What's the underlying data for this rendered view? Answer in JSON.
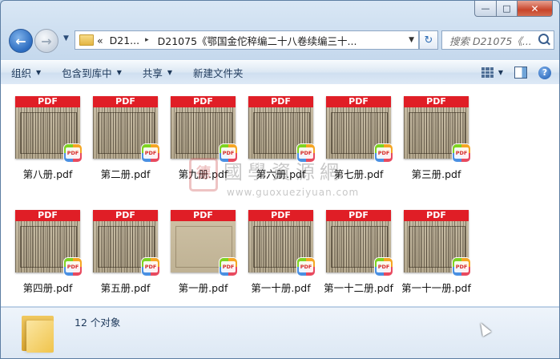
{
  "window": {
    "caption_buttons": {
      "minimize": "—",
      "maximize": "□",
      "close": "✕"
    }
  },
  "nav": {
    "back_glyph": "←",
    "forward_glyph": "→",
    "history_glyph": "▼",
    "address": {
      "overflow": "«",
      "crumb1": "D21...",
      "crumb2": "D21075《鄂国金佗稡编二十八卷续编三十...",
      "separator": "▸",
      "dropdown": "▼"
    },
    "refresh_glyph": "↻",
    "search_placeholder": "搜索 D21075《..."
  },
  "toolbar": {
    "organize": "组织",
    "include_in_library": "包含到库中",
    "share": "共享",
    "new_folder": "新建文件夹",
    "dropdown_glyph": "▼",
    "help_glyph": "?"
  },
  "files": [
    {
      "name": "第八册.pdf",
      "badge": "PDF",
      "plain": false
    },
    {
      "name": "第二册.pdf",
      "badge": "PDF",
      "plain": false
    },
    {
      "name": "第九册.pdf",
      "badge": "PDF",
      "plain": false
    },
    {
      "name": "第六册.pdf",
      "badge": "PDF",
      "plain": false
    },
    {
      "name": "第七册.pdf",
      "badge": "PDF",
      "plain": false
    },
    {
      "name": "第三册.pdf",
      "badge": "PDF",
      "plain": false
    },
    {
      "name": "第四册.pdf",
      "badge": "PDF",
      "plain": false
    },
    {
      "name": "第五册.pdf",
      "badge": "PDF",
      "plain": false
    },
    {
      "name": "第一册.pdf",
      "badge": "PDF",
      "plain": true
    },
    {
      "name": "第一十册.pdf",
      "badge": "PDF",
      "plain": false
    },
    {
      "name": "第一十二册.pdf",
      "badge": "PDF",
      "plain": false
    },
    {
      "name": "第一十一册.pdf",
      "badge": "PDF",
      "plain": false
    }
  ],
  "watermark": {
    "seal": "德",
    "title": "國學資源網",
    "url": "www.guoxueziyuan.com"
  },
  "details": {
    "count": "12 个对象"
  }
}
